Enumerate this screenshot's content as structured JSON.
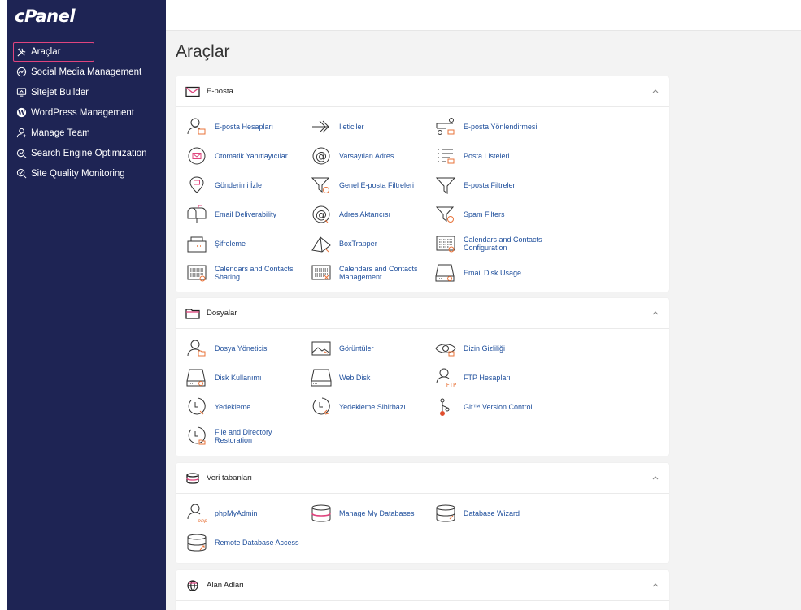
{
  "brand": {
    "logo_text": "cPanel"
  },
  "colors": {
    "sidebar_bg": "#1e2454",
    "active_border": "#e0447e",
    "link": "#1f4f9c",
    "icon_accent": "#e8733a"
  },
  "sidebar": {
    "items": [
      {
        "label": "Araçlar",
        "icon": "tools-icon",
        "active": true
      },
      {
        "label": "Social Media Management",
        "icon": "social-icon"
      },
      {
        "label": "Sitejet Builder",
        "icon": "monitor-icon"
      },
      {
        "label": "WordPress Management",
        "icon": "wordpress-icon"
      },
      {
        "label": "Manage Team",
        "icon": "user-icon"
      },
      {
        "label": "Search Engine Optimization",
        "icon": "seo-icon"
      },
      {
        "label": "Site Quality Monitoring",
        "icon": "quality-icon"
      }
    ]
  },
  "page": {
    "title": "Araçlar"
  },
  "sections": [
    {
      "title": "E-posta",
      "icon": "mail-icon",
      "tools": [
        {
          "label": "E-posta Hesapları",
          "icon": "user-mail-icon"
        },
        {
          "label": "İleticiler",
          "icon": "forward-icon"
        },
        {
          "label": "E-posta Yönlendirmesi",
          "icon": "routing-icon"
        },
        {
          "label": "Otomatik Yanıtlayıcılar",
          "icon": "autoresponder-icon"
        },
        {
          "label": "Varsayılan Adres",
          "icon": "at-icon"
        },
        {
          "label": "Posta Listeleri",
          "icon": "list-icon"
        },
        {
          "label": "Gönderimi İzle",
          "icon": "track-icon"
        },
        {
          "label": "Genel E-posta Filtreleri",
          "icon": "filter-global-icon"
        },
        {
          "label": "E-posta Filtreleri",
          "icon": "filter-icon"
        },
        {
          "label": "Email Deliverability",
          "icon": "mailbox-icon"
        },
        {
          "label": "Adres Aktarıcısı",
          "icon": "at-import-icon"
        },
        {
          "label": "Spam Filters",
          "icon": "spam-filter-icon"
        },
        {
          "label": "Şifreleme",
          "icon": "encryption-icon"
        },
        {
          "label": "BoxTrapper",
          "icon": "boxtrapper-icon"
        },
        {
          "label": "Calendars and Contacts Configuration",
          "icon": "calendar-config-icon"
        },
        {
          "label": "Calendars and Contacts Sharing",
          "icon": "calendar-share-icon"
        },
        {
          "label": "Calendars and Contacts Management",
          "icon": "calendar-manage-icon"
        },
        {
          "label": "Email Disk Usage",
          "icon": "disk-usage-icon"
        }
      ]
    },
    {
      "title": "Dosyalar",
      "icon": "folder-icon",
      "tools": [
        {
          "label": "Dosya Yöneticisi",
          "icon": "file-manager-icon"
        },
        {
          "label": "Görüntüler",
          "icon": "image-icon"
        },
        {
          "label": "Dizin Gizliliği",
          "icon": "eye-icon"
        },
        {
          "label": "Disk Kullanımı",
          "icon": "disk-icon"
        },
        {
          "label": "Web Disk",
          "icon": "webdisk-icon"
        },
        {
          "label": "FTP Hesapları",
          "icon": "ftp-icon"
        },
        {
          "label": "Yedekleme",
          "icon": "backup-icon"
        },
        {
          "label": "Yedekleme Sihirbazı",
          "icon": "backup-wizard-icon"
        },
        {
          "label": "Git™ Version Control",
          "icon": "git-icon"
        },
        {
          "label": "File and Directory Restoration",
          "icon": "restore-icon"
        }
      ]
    },
    {
      "title": "Veri tabanları",
      "icon": "database-icon",
      "tools": [
        {
          "label": "phpMyAdmin",
          "icon": "phpmyadmin-icon"
        },
        {
          "label": "Manage My Databases",
          "icon": "db-manage-icon"
        },
        {
          "label": "Database Wizard",
          "icon": "db-wizard-icon"
        },
        {
          "label": "Remote Database Access",
          "icon": "db-remote-icon"
        }
      ]
    },
    {
      "title": "Alan Adları",
      "icon": "globe-icon",
      "tools": []
    }
  ]
}
